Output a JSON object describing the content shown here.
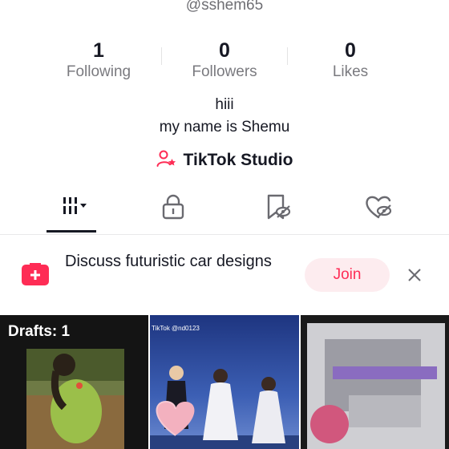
{
  "profile": {
    "username": "@sshem65",
    "stats": [
      {
        "value": "1",
        "label": "Following"
      },
      {
        "value": "0",
        "label": "Followers"
      },
      {
        "value": "0",
        "label": "Likes"
      }
    ],
    "bio_line1": "hiii",
    "bio_line2": "my name is Shemu",
    "studio_label": "TikTok Studio"
  },
  "tabs": [
    {
      "icon": "videos-grid-icon",
      "active": true
    },
    {
      "icon": "lock-icon",
      "active": false
    },
    {
      "icon": "favorites-hidden-icon",
      "active": false
    },
    {
      "icon": "liked-hidden-icon",
      "active": false
    }
  ],
  "banner": {
    "icon": "group-chat-icon",
    "text": "Discuss futuristic car designs",
    "join_label": "Join",
    "close_icon": "close-icon"
  },
  "grid": {
    "drafts_label": "Drafts: 1",
    "watermark": "TikTok\n@nd0123"
  },
  "colors": {
    "accent": "#fe2c55",
    "join_bg": "#fdecef",
    "text_primary": "#161823",
    "text_secondary": "#7a7a7f"
  }
}
